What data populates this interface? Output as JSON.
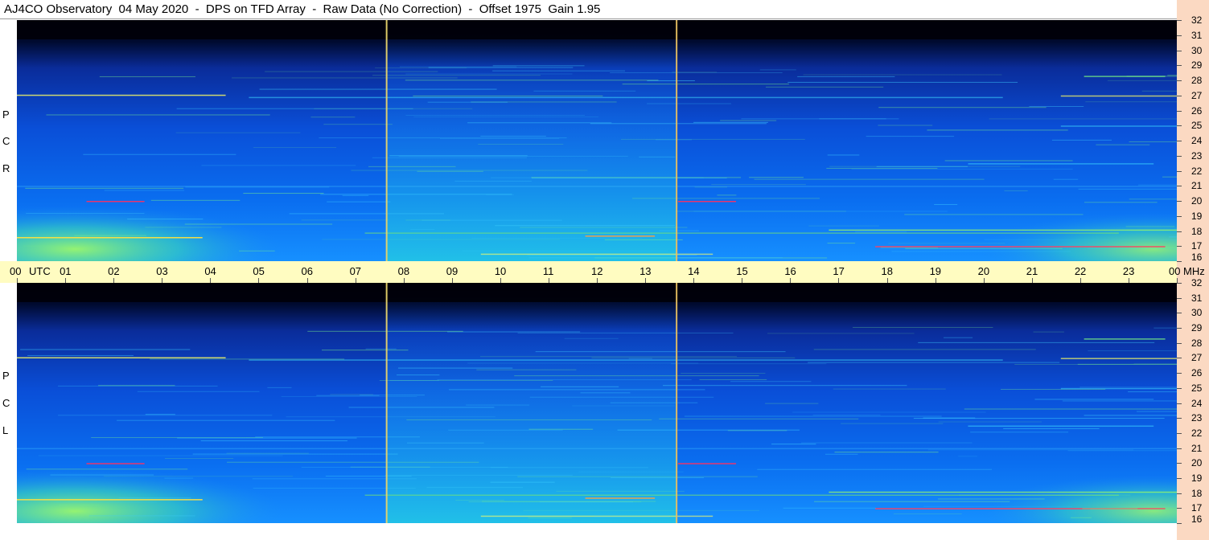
{
  "title": "AJ4CO Observatory  04 May 2020  -  DPS on TFD Array  -  Raw Data (No Correction)  -  Offset 1975  Gain 1.95",
  "chart_data": {
    "type": "heatmap",
    "title": "AJ4CO Observatory  04 May 2020  -  DPS on TFD Array  -  Raw Data (No Correction)  -  Offset 1975  Gain 1.95",
    "x_axis": {
      "label": "UTC",
      "ticks": [
        "00",
        "01",
        "02",
        "03",
        "04",
        "05",
        "06",
        "07",
        "08",
        "09",
        "10",
        "11",
        "12",
        "13",
        "14",
        "15",
        "16",
        "17",
        "18",
        "19",
        "20",
        "21",
        "22",
        "23",
        "00"
      ],
      "range_hours": [
        0,
        24
      ]
    },
    "y_axis": {
      "label": "MHz",
      "ticks": [
        "32",
        "31",
        "30",
        "29",
        "28",
        "27",
        "26",
        "25",
        "24",
        "23",
        "22",
        "21",
        "20",
        "19",
        "18",
        "17",
        "16"
      ],
      "range_mhz": [
        16,
        32
      ]
    },
    "panels": [
      {
        "name": "RCP",
        "label_letters": [
          "P",
          "C",
          "R"
        ]
      },
      {
        "name": "LCP",
        "label_letters": [
          "P",
          "C",
          "L"
        ]
      }
    ],
    "vertical_markers_utc": [
      7.65,
      13.65
    ],
    "colormap": [
      "#000010",
      "#001a66",
      "#0050e6",
      "#0096ff",
      "#19d2e6",
      "#7ff07f",
      "#ffff40",
      "#ff4040"
    ]
  }
}
